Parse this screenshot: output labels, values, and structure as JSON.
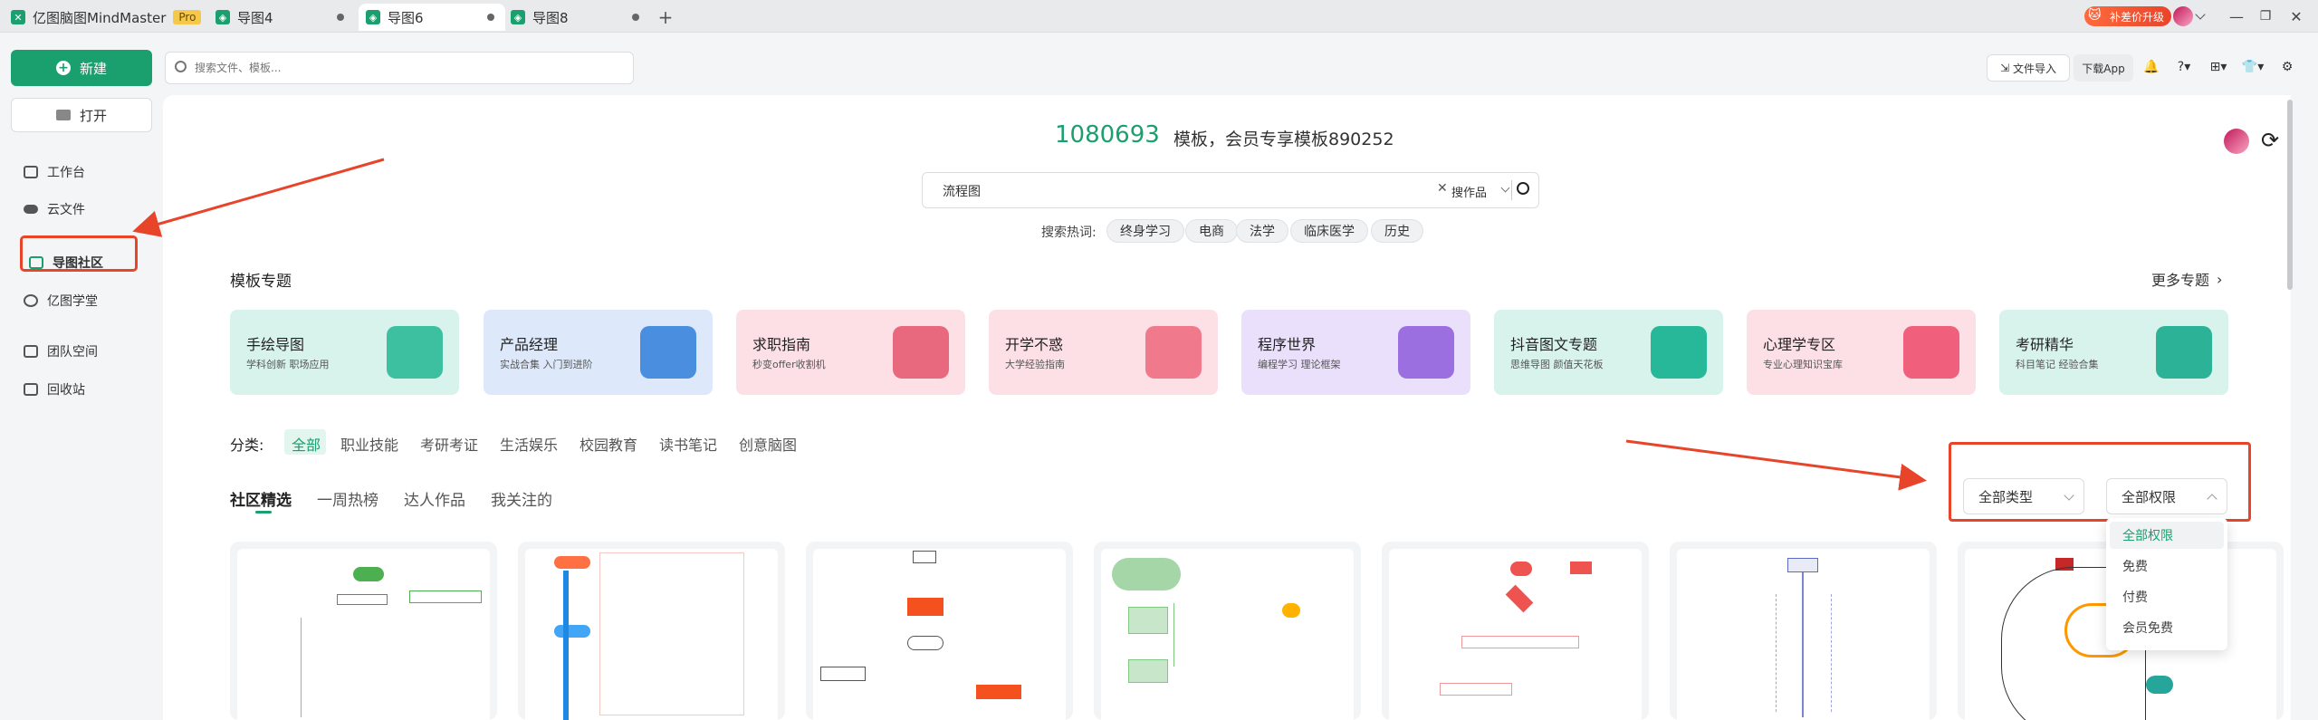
{
  "tabs": [
    {
      "label": "亿图脑图MindMaster",
      "badge": "Pro"
    },
    {
      "label": "导图4"
    },
    {
      "label": "导图6"
    },
    {
      "label": "导图8"
    }
  ],
  "topright": {
    "upgrade": "补差价升级"
  },
  "sidebar": {
    "new_label": "新建",
    "open_label": "打开",
    "items": [
      {
        "label": "工作台"
      },
      {
        "label": "云文件"
      },
      {
        "label": "导图社区"
      },
      {
        "label": "亿图学堂"
      },
      {
        "label": "团队空间"
      },
      {
        "label": "回收站"
      }
    ]
  },
  "search": {
    "placeholder": "搜索文件、模板..."
  },
  "header_right": {
    "import": "文件导入",
    "download": "下载App"
  },
  "hero": {
    "count": "1080693",
    "text": "模板，会员专享模板890252",
    "query": "流程图",
    "scope": "搜作品",
    "hot_label": "搜索热词:",
    "hot": [
      "终身学习",
      "电商",
      "法学",
      "临床医学",
      "历史"
    ]
  },
  "topics": {
    "title": "模板专题",
    "more": "更多专题",
    "cards": [
      {
        "title": "手绘导图",
        "sub": "学科创新 职场应用",
        "bg": "#d8f3ec",
        "art": "#3dc0a0"
      },
      {
        "title": "产品经理",
        "sub": "实战合集 入门到进阶",
        "bg": "#dde9fb",
        "art": "#4a8ee0"
      },
      {
        "title": "求职指南",
        "sub": "秒变offer收割机",
        "bg": "#fde0e6",
        "art": "#e8687e"
      },
      {
        "title": "开学不惑",
        "sub": "大学经验指南",
        "bg": "#fde0e6",
        "art": "#f07a8c"
      },
      {
        "title": "程序世界",
        "sub": "编程学习 理论框架",
        "bg": "#ebe0fb",
        "art": "#9b6fe0"
      },
      {
        "title": "抖音图文专题",
        "sub": "思维导图 颜值天花板",
        "bg": "#d8f3ec",
        "art": "#27b89a"
      },
      {
        "title": "心理学专区",
        "sub": "专业心理知识宝库",
        "bg": "#fde0e6",
        "art": "#f05f7b"
      },
      {
        "title": "考研精华",
        "sub": "科目笔记 经验合集",
        "bg": "#d8f3ec",
        "art": "#2cb296"
      }
    ]
  },
  "categories": {
    "label": "分类:",
    "items": [
      "全部",
      "职业技能",
      "考研考证",
      "生活娱乐",
      "校园教育",
      "读书笔记",
      "创意脑图"
    ]
  },
  "panel_tabs": [
    "社区精选",
    "一周热榜",
    "达人作品",
    "我关注的"
  ],
  "filters": {
    "type": "全部类型",
    "permission": "全部权限",
    "options": [
      "全部权限",
      "免费",
      "付费",
      "会员免费"
    ]
  },
  "colors": {
    "brand": "#1aa06e",
    "annotation": "#e8442a"
  }
}
